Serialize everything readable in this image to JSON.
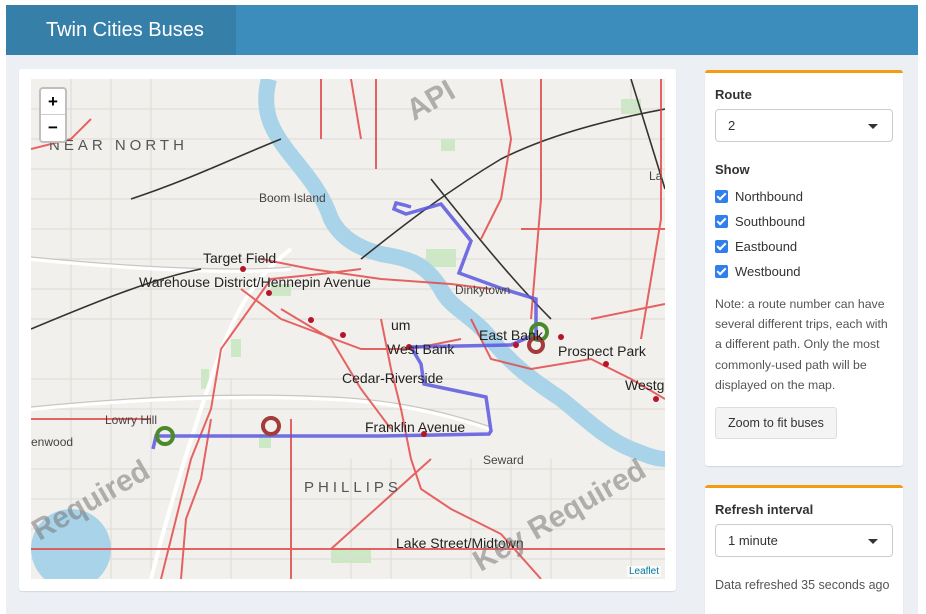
{
  "app": {
    "title": "Twin Cities Buses"
  },
  "map": {
    "zoom_in": "+",
    "zoom_out": "−",
    "attribution": "Leaflet",
    "labels": [
      {
        "id": "near-north",
        "text": "NEAR NORTH"
      },
      {
        "id": "boom-island",
        "text": "Boom Island"
      },
      {
        "id": "target-field",
        "text": "Target Field"
      },
      {
        "id": "warehouse",
        "text": "Warehouse District/Hennepin Avenue"
      },
      {
        "id": "dinkytown",
        "text": "Dinkytown"
      },
      {
        "id": "east-bank",
        "text": "East Bank"
      },
      {
        "id": "west-bank",
        "text": "West Bank"
      },
      {
        "id": "prospect-park",
        "text": "Prospect Park"
      },
      {
        "id": "cedar-riverside",
        "text": "Cedar-Riverside"
      },
      {
        "id": "lowry-hill",
        "text": "Lowry Hill"
      },
      {
        "id": "kenwood",
        "text": "enwood"
      },
      {
        "id": "franklin-avenue",
        "text": "Franklin Avenue"
      },
      {
        "id": "seward",
        "text": "Seward"
      },
      {
        "id": "phillips",
        "text": "PHILLIPS"
      },
      {
        "id": "lake-street",
        "text": "Lake Street/Midtown"
      },
      {
        "id": "la",
        "text": "La"
      },
      {
        "id": "westg",
        "text": "Westg"
      },
      {
        "id": "um",
        "text": "um"
      }
    ],
    "watermarks": [
      "API",
      "Required",
      "Key Required"
    ],
    "colors": {
      "route": "#5a57e0",
      "rail": "#e34a4a",
      "water": "#a9d3e8",
      "park": "#cde8c4",
      "start": "#4a8a2a",
      "end": "#a33b3b"
    }
  },
  "controls": {
    "route_label": "Route",
    "route_value": "2",
    "show_label": "Show",
    "directions": [
      "Northbound",
      "Southbound",
      "Eastbound",
      "Westbound"
    ],
    "note": "Note: a route number can have several different trips, each with a different path. Only the most commonly-used path will be displayed on the map.",
    "zoom_button": "Zoom to fit buses"
  },
  "refresh": {
    "label": "Refresh interval",
    "value": "1 minute",
    "status": "Data refreshed 35 seconds ago"
  }
}
